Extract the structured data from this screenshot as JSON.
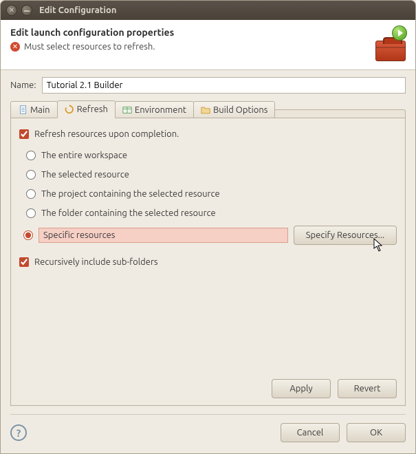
{
  "window": {
    "title": "Edit Configuration"
  },
  "header": {
    "title": "Edit launch configuration properties",
    "error_msg": "Must select resources to refresh."
  },
  "name_section": {
    "label": "Name:",
    "value": "Tutorial 2.1 Builder"
  },
  "tabs": {
    "main": "Main",
    "refresh": "Refresh",
    "environment": "Environment",
    "build": "Build Options"
  },
  "refresh_panel": {
    "refresh_on_complete": "Refresh resources upon completion.",
    "radios": {
      "entire_workspace": "The entire workspace",
      "selected_resource": "The selected resource",
      "project_containing": "The project containing the selected resource",
      "folder_containing": "The folder containing the selected resource",
      "specific_resources": "Specific resources"
    },
    "specify_button": "Specify Resources...",
    "recursive": "Recursively include sub-folders"
  },
  "buttons": {
    "apply": "Apply",
    "revert": "Revert",
    "cancel": "Cancel",
    "ok": "OK"
  }
}
